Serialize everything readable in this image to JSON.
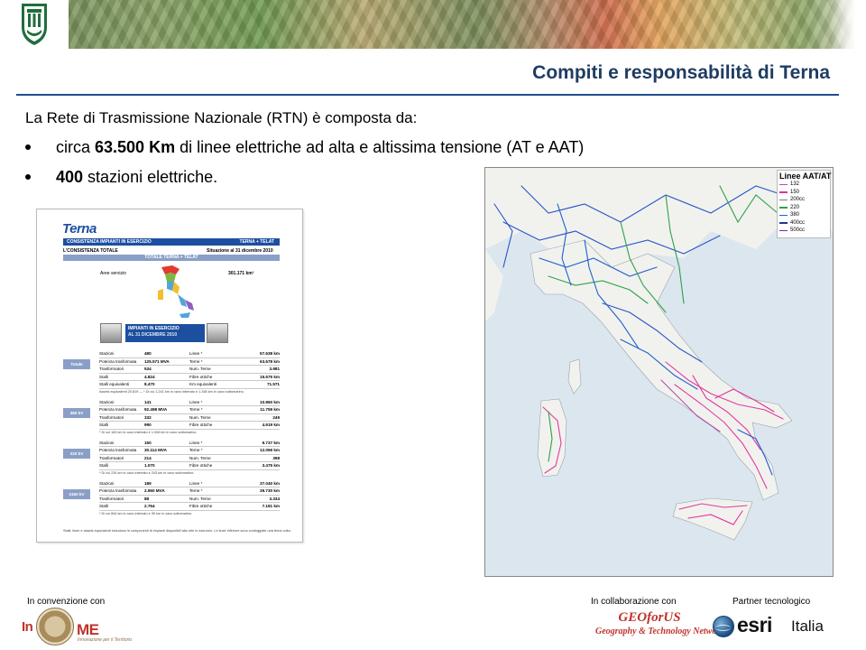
{
  "header": {
    "title": "Compiti e responsabilità di Terna"
  },
  "content": {
    "intro": "La Rete di Trasmissione Nazionale (RTN) è composta da:",
    "bullets": [
      {
        "prefix": "circa ",
        "strong": "63.500 Km",
        "suffix": " di linee elettriche ad alta e altissima tensione (AT e AAT)"
      },
      {
        "prefix": "",
        "strong": "400",
        "suffix": " stazioni elettriche."
      }
    ]
  },
  "document": {
    "brand": "Terna",
    "bar_title": "CONSISTENZA IMPIANTI IN ESERCIZIO",
    "bar_right": "TERNA + TELAT",
    "subtitle": "L’CONSISTENZA TOTALE",
    "subtitle_right": "Situazione al 31 dicembre 2010",
    "band": "TOTALE TERNA + TELAT",
    "area_label": "Aree servizio",
    "area_value": "301.171 km²",
    "impianti_title": "IMPIANTI IN ESERCIZIO",
    "impianti_sub": "AL 31 DICEMBRE 2010",
    "sections": [
      {
        "label": "Totale",
        "rows": [
          [
            "Stazioni",
            "480",
            "Linee *",
            "57.638 km"
          ],
          [
            "Potenza trasformata",
            "125.571 MVA",
            "Terne *",
            "63.678 km"
          ],
          [
            "Trasformatori",
            "534",
            "Num. Terne",
            "3.981"
          ],
          [
            "Stalli",
            "4.824",
            "Fibre ottiche",
            "15.575 km"
          ],
          [
            "Stalli equivalenti",
            "8.470",
            "Km equivalenti",
            "71.571"
          ]
        ],
        "note": "Assets equivalenti  20.819  —  * Di cui 1.241 km in cavo interrato e 1.348 km in cavo sottomarino."
      },
      {
        "label": "380 kV",
        "rows": [
          [
            "Stazioni",
            "141",
            "Linee *",
            "10.860 km"
          ],
          [
            "Potenza trasformata",
            "92.498 MVA",
            "Terne *",
            "11.759 km"
          ],
          [
            "Trasformatori",
            "332",
            "Num. Terne",
            "249"
          ],
          [
            "Stalli",
            "990",
            "Fibre ottiche",
            "4.919 km"
          ]
        ],
        "note": "* Di cui 163 km in cavo interrato e 1.006 km in cavo sottomarino."
      },
      {
        "label": "220 kV",
        "rows": [
          [
            "Stazioni",
            "150",
            "Linee *",
            "9.737 km"
          ],
          [
            "Potenza trasformata",
            "30.114 MVA",
            "Terne *",
            "12.059 km"
          ],
          [
            "Trasformatori",
            "214",
            "Num. Terne",
            "398"
          ],
          [
            "Stalli",
            "1.070",
            "Fibre ottiche",
            "3.475 km"
          ]
        ],
        "note": "* Di cui 234 km in cavo interrato e 243 km in cavo sottomarino."
      },
      {
        "label": "≤150 kV",
        "rows": [
          [
            "Stazioni",
            "189",
            "Linee *",
            "37.040 km"
          ],
          [
            "Potenza trasformata",
            "2.960 MVA",
            "Terne *",
            "39.730 km"
          ],
          [
            "Trasformatori",
            "88",
            "Num. Terne",
            "3.334"
          ],
          [
            "Stalli",
            "2.764",
            "Fibre ottiche",
            "7.181 km"
          ]
        ],
        "note": "* Di cui 844 km in cavo interrato e 99 km in cavo sottomarino."
      }
    ],
    "footnote": "Stalli, linee e assets equivalenti includono le componenti di impianti disponibili alla rete in esercizio. Le linee inferiore sono conteggiate una terna volta."
  },
  "map": {
    "legend_title": "Linee AAT/AT",
    "legend": [
      {
        "label": "132",
        "color": "#b44db0"
      },
      {
        "label": "150",
        "color": "#e3309a"
      },
      {
        "label": "200cc",
        "color": "#7a7a7a"
      },
      {
        "label": "220",
        "color": "#2fa14a"
      },
      {
        "label": "380",
        "color": "#1f5fd0"
      },
      {
        "label": "400cc",
        "color": "#1b3b8f"
      },
      {
        "label": "500cc",
        "color": "#6e2ab3"
      }
    ],
    "colors": {
      "sea": "#dce6ee",
      "land": "#f1f2ee",
      "south_lines": "#e23aa0",
      "north_lines": "#2a55c8"
    }
  },
  "footer": {
    "label_left": "In convenzione con",
    "label_mid": "In collaborazione con",
    "label_right": "Partner tecnologico",
    "itime_a": "In",
    "itime_b": "ME",
    "itime_sub": "Innovazione per il Territorio",
    "geo_main": "GEOforUS",
    "geo_sub": "Geography & Technology Network",
    "esri": "esri",
    "esri_country": "Italia"
  }
}
